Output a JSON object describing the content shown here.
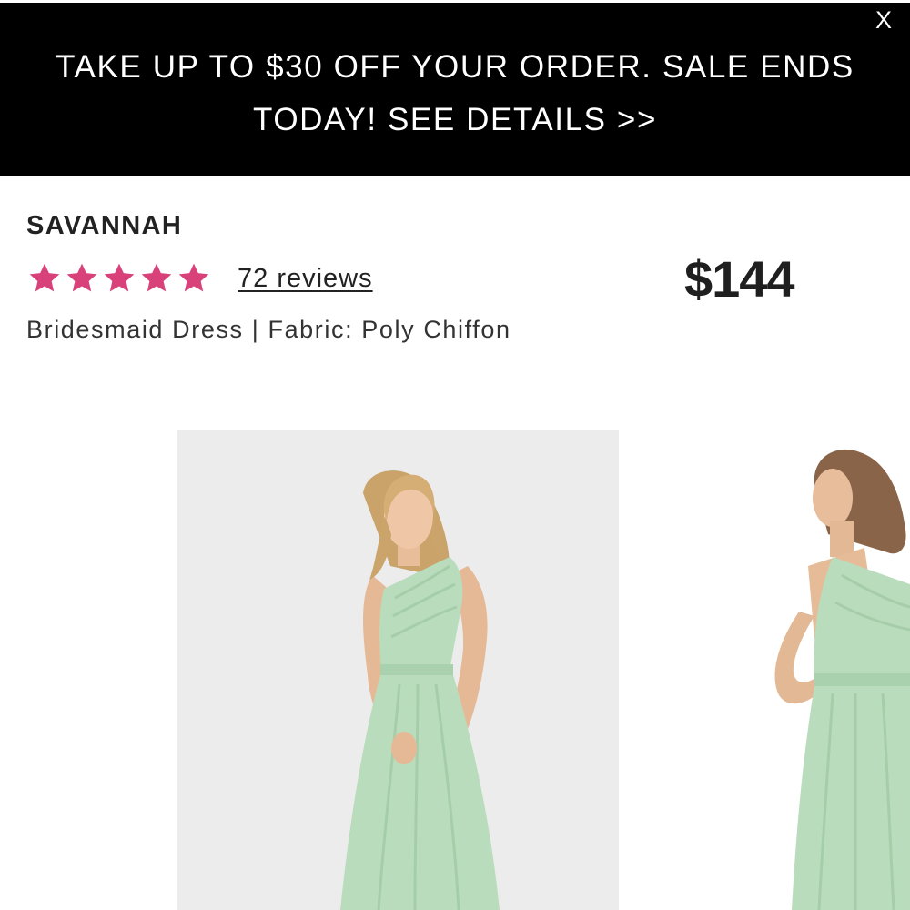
{
  "promo": {
    "text": "TAKE UP TO $30 OFF YOUR ORDER. SALE ENDS TODAY! SEE DETAILS >>",
    "close_label": "X"
  },
  "product": {
    "name": "SAVANNAH",
    "rating": 5,
    "rating_max": 5,
    "reviews_label": "72 reviews",
    "price": "$144",
    "subtitle": "Bridesmaid Dress | Fabric: Poly Chiffon"
  },
  "colors": {
    "banner_bg": "#000000",
    "star": "#d9417a",
    "dress": "#b9dcbc"
  },
  "icons": {
    "star": "star-icon",
    "close": "close-icon"
  }
}
